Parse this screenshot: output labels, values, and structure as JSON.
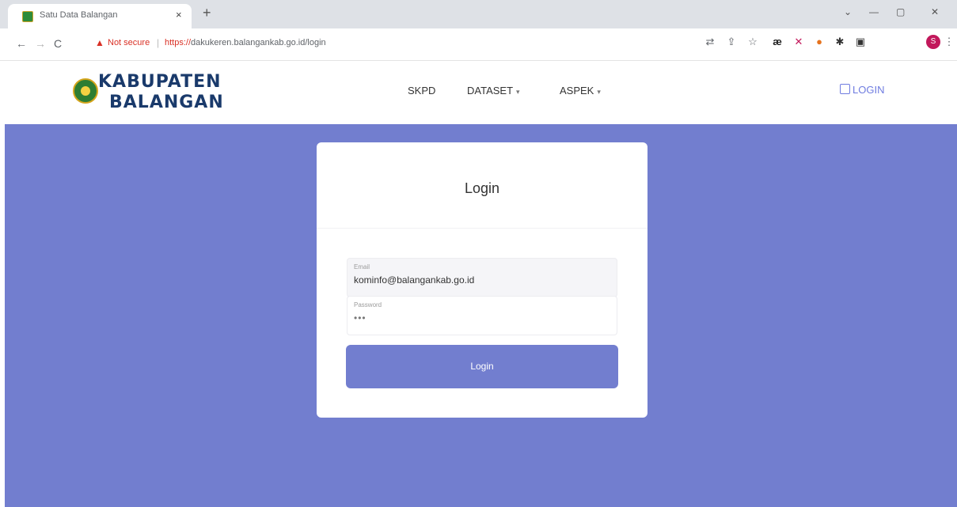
{
  "browser": {
    "tab_title": "Satu Data Balangan",
    "tab_close": "×",
    "new_tab": "+",
    "window_controls": {
      "collapse": "⌄",
      "minimize": "—",
      "maximize": "▢",
      "close": "✕"
    },
    "nav": {
      "back": "←",
      "forward": "→",
      "reload": "C"
    },
    "security_label": "Not secure",
    "url_scheme": "https://",
    "url_rest": "dakukeren.balangankab.go.id/login",
    "extensions": [
      "translate-icon",
      "share-icon",
      "star-icon",
      "ae-icon",
      "cross-ext-icon",
      "colorful-ext-icon",
      "puzzle-icon",
      "sidebar-icon"
    ],
    "profile_initial": "S",
    "menu": "⋮"
  },
  "header": {
    "logo_line1": "KABUPATEN",
    "logo_line2": "BALANGAN",
    "nav": [
      {
        "label": "SKPD",
        "dropdown": false
      },
      {
        "label": "DATASET",
        "dropdown": true
      },
      {
        "label": "ASPEK",
        "dropdown": true
      }
    ],
    "login_label": "LOGIN"
  },
  "login_form": {
    "title": "Login",
    "email_label": "Email",
    "email_value": "kominfo@balangankab.go.id",
    "password_label": "Password",
    "password_value": "•••",
    "submit_label": "Login"
  },
  "colors": {
    "accent": "#727ecf",
    "warning": "#d93025",
    "logo_text": "#1a3a6b"
  }
}
